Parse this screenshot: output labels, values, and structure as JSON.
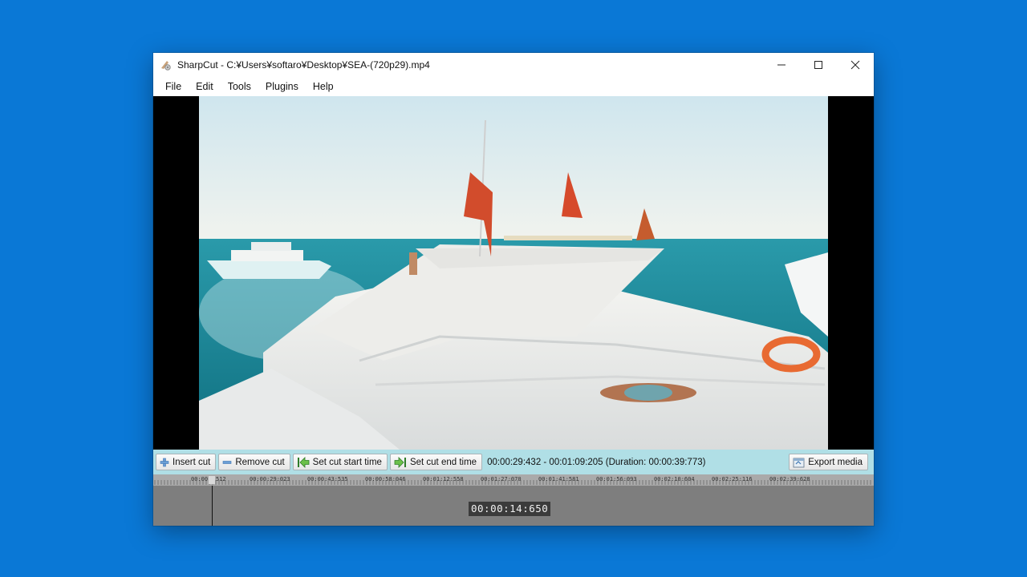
{
  "window": {
    "title": "SharpCut - C:¥Users¥softaro¥Desktop¥SEA-(720p29).mp4",
    "controls": {
      "minimize": "minimize-icon",
      "maximize": "maximize-icon",
      "close": "close-icon"
    }
  },
  "menu": {
    "items": [
      {
        "label": "File"
      },
      {
        "label": "Edit"
      },
      {
        "label": "Tools"
      },
      {
        "label": "Plugins"
      },
      {
        "label": "Help"
      }
    ]
  },
  "video": {
    "content": "yacht deck at sea"
  },
  "toolbar": {
    "insert_cut": "Insert cut",
    "remove_cut": "Remove cut",
    "set_start": "Set cut start time",
    "set_end": "Set cut end time",
    "range_text": "00:00:29:432 - 00:01:09:205 (Duration: 00:00:39:773)",
    "export": "Export media"
  },
  "timeline": {
    "ticks": [
      "00:00",
      "512",
      "00:00:29:023",
      "00:00:43:535",
      "00:00:58:046",
      "00:01:12:558",
      "00:01:27:070",
      "00:01:41:581",
      "00:01:56:093",
      "00:02:10:604",
      "00:02:25:116",
      "00:02:39:628"
    ],
    "current_time": "00:00:14:650"
  },
  "colors": {
    "desktop": "#0a78d6",
    "toolbar": "#b0dfe6",
    "timeline": "#7e7e7e"
  }
}
